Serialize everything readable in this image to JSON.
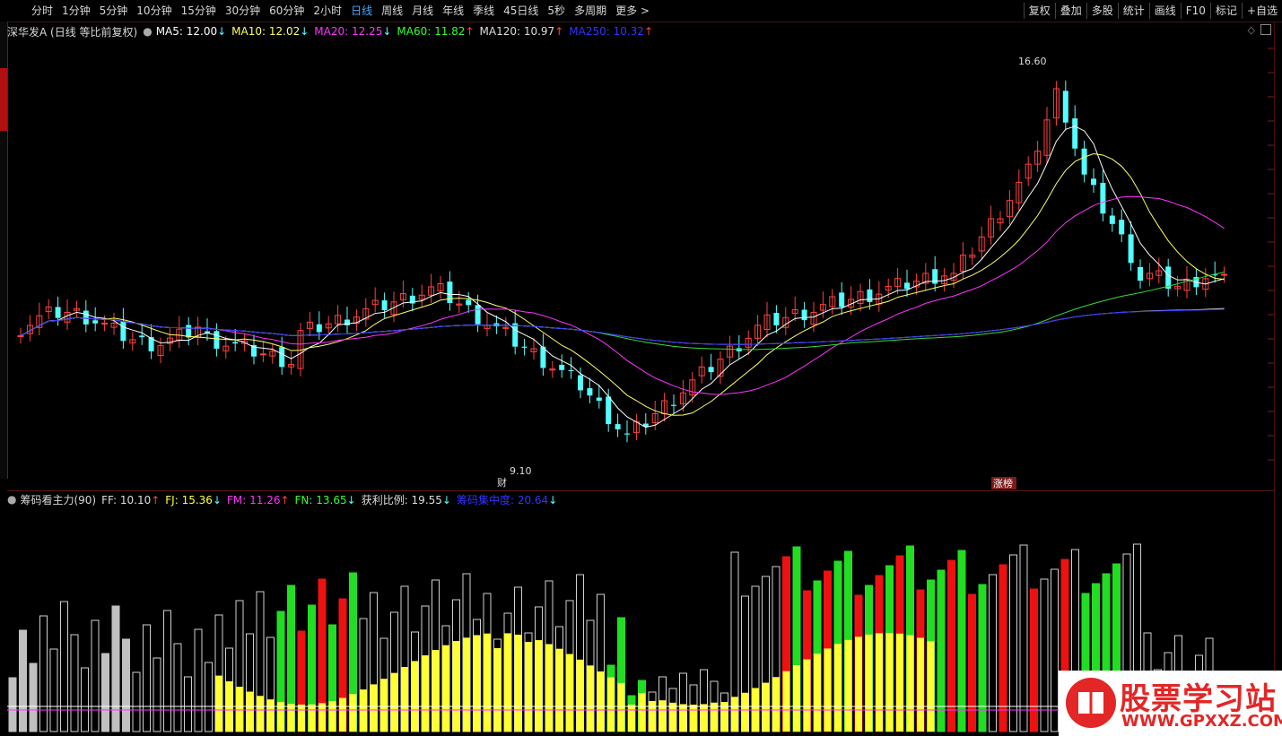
{
  "topbar": {
    "tabs": [
      "分时",
      "1分钟",
      "5分钟",
      "10分钟",
      "15分钟",
      "30分钟",
      "60分钟",
      "2小时",
      "日线",
      "周线",
      "月线",
      "年线",
      "季线",
      "45日线",
      "5秒",
      "多周期",
      "更多 >"
    ],
    "active_tab": "日线",
    "tools": [
      "复权",
      "叠加",
      "多股",
      "统计",
      "画线",
      "F10",
      "标记",
      "+自选"
    ]
  },
  "price_header": {
    "stock": "深华发A (日线 等比前复权)",
    "ma": [
      {
        "label": "MA5: 12.00",
        "arrow": "↓",
        "color": "#ffffff"
      },
      {
        "label": "MA10: 12.02",
        "arrow": "↓",
        "color": "#ffff66"
      },
      {
        "label": "MA20: 12.25",
        "arrow": "↓",
        "color": "#ff33ff"
      },
      {
        "label": "MA60: 11.82",
        "arrow": "↑",
        "color": "#33ff33"
      },
      {
        "label": "MA120: 10.97",
        "arrow": "↑",
        "color": "#dddddd"
      },
      {
        "label": "MA250: 10.32",
        "arrow": "↑",
        "color": "#3333ff"
      }
    ]
  },
  "annotations": {
    "high": "16.60",
    "low": "9.10",
    "cai": "财",
    "zhangbang": "涨榜"
  },
  "indicator_header": {
    "title": "筹码看主力(90)",
    "items": [
      {
        "label": "FF: 10.10",
        "arrow": "↑",
        "color": "#dddddd"
      },
      {
        "label": "FJ: 15.36",
        "arrow": "↓",
        "color": "#ffff33"
      },
      {
        "label": "FM: 11.26",
        "arrow": "↑",
        "color": "#ff33ff"
      },
      {
        "label": "FN: 13.65",
        "arrow": "↓",
        "color": "#33ff33"
      },
      {
        "label": "获利比例: 19.55",
        "arrow": "↓",
        "color": "#dddddd"
      },
      {
        "label": "筹码集中度: 20.64",
        "arrow": "↓",
        "color": "#3333ff"
      }
    ]
  },
  "watermark": {
    "title": "股票学习站",
    "url": "WWW.GPXXZ.COM"
  },
  "colors": {
    "up": "#ff4040",
    "down": "#54ffff",
    "yellow": "#ffff33",
    "green": "#22dd22",
    "red": "#ee1111",
    "gray": "#c0c0c0"
  }
}
